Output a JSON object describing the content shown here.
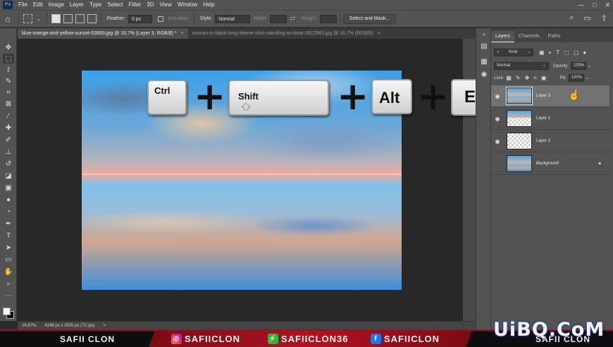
{
  "app": {
    "menu": [
      "File",
      "Edit",
      "Image",
      "Layer",
      "Type",
      "Select",
      "Filter",
      "3D",
      "View",
      "Window",
      "Help"
    ],
    "logo_text": "Ps",
    "window_controls": [
      "—",
      "□",
      "✕"
    ]
  },
  "options": {
    "feather_label": "Feather:",
    "feather_value": "0 px",
    "antialias_label": "Anti-alias",
    "style_label": "Style:",
    "style_value": "Normal",
    "width_label": "Width:",
    "height_label": "Height:",
    "select_mask_label": "Select and Mask..."
  },
  "tabs": [
    {
      "title": "blue-orange-and-yellow-sunset-53893.jpg @ 16,7% (Layer 3, RGB/8) *",
      "close": "×"
    },
    {
      "title": "woman-in-black-long-sleeve-shirt-standing-on-boat-3922943.jpg @ 16,7% (RGB/8)",
      "close": "×"
    }
  ],
  "status": {
    "zoom": "16,67%",
    "doc_info": "4248 px x 2925 px (72 ppi)",
    "arrow": ">"
  },
  "shortcut": {
    "keys": [
      "Ctrl",
      "Shift",
      "Alt",
      "E"
    ],
    "plus": "+"
  },
  "panel": {
    "tabs": [
      "Layers",
      "Channels",
      "Paths"
    ],
    "kind_label": "Kind",
    "blend_mode": "Normal",
    "opacity_label": "Opacity:",
    "opacity_value": "100%",
    "lock_label": "Lock:",
    "fill_label": "Fill:",
    "fill_value": "100%",
    "layers": [
      {
        "name": "Layer 3",
        "visible": true,
        "selected": true
      },
      {
        "name": "Layer 1",
        "visible": true,
        "selected": false
      },
      {
        "name": "Layer 2",
        "visible": true,
        "selected": false
      },
      {
        "name": "Background",
        "visible": false,
        "selected": false,
        "locked": true
      }
    ]
  },
  "banner": {
    "left_brand": "SAFII CLON",
    "instagram": "SAFIICLON",
    "second_social": "SAFIICLON36",
    "facebook": "SAFIICLON",
    "right_brand": "SAFII CLON",
    "accent_color": "#b21220"
  },
  "watermark": "UiBQ.CoM",
  "icons": {
    "toolbar": [
      "move-icon",
      "marquee-icon",
      "lasso-icon",
      "quick-select-icon",
      "crop-icon",
      "frame-icon",
      "eyedropper-icon",
      "healing-icon",
      "brush-icon",
      "stamp-icon",
      "history-brush-icon",
      "eraser-icon",
      "gradient-icon",
      "blur-icon",
      "dodge-icon",
      "pen-icon",
      "type-icon",
      "path-select-icon",
      "rectangle-icon",
      "hand-icon",
      "zoom-icon",
      "more-icon"
    ]
  }
}
